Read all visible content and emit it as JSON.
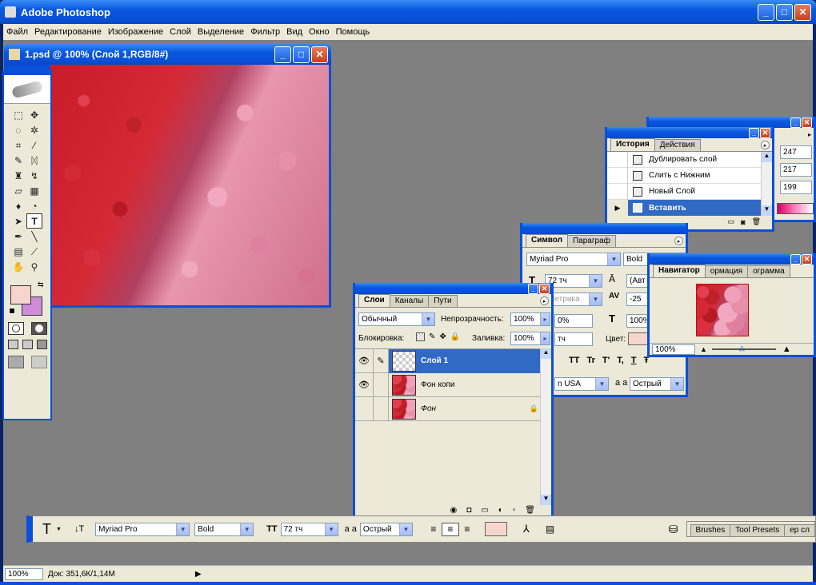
{
  "app": {
    "title": "Adobe Photoshop",
    "menu": [
      "Файл",
      "Редактирование",
      "Изображение",
      "Слой",
      "Выделение",
      "Фильтр",
      "Вид",
      "Окно",
      "Помощь"
    ]
  },
  "document": {
    "title": "1.psd @ 100% (Слой 1,RGB/8#)"
  },
  "history": {
    "tabs": [
      "История",
      "Действия"
    ],
    "items": [
      "Дублировать слой",
      "Слить с Нижним",
      "Новый Слой",
      "Вставить"
    ],
    "selected_index": 3,
    "values": [
      "247",
      "217",
      "199"
    ]
  },
  "character": {
    "tabs": [
      "Символ",
      "Параграф"
    ],
    "font": "Myriad Pro",
    "style": "Bold",
    "size": "72 тч",
    "leading": "(Авт",
    "kerning": "Метрика",
    "tracking": "-25",
    "vscale": "0%",
    "hscale": "100%",
    "baseline": "тч",
    "color_label": "Цвет:",
    "lang": "n USA",
    "aa": "Острый",
    "aa_icon": "a a",
    "style_buttons": [
      "TT",
      "Tr",
      "T'",
      "T,",
      "T",
      "Ŧ"
    ]
  },
  "navigator": {
    "tabs": [
      "Навигатор",
      "ормация",
      "ограмма"
    ],
    "zoom": "100%"
  },
  "layers": {
    "tabs": [
      "Слои",
      "Каналы",
      "Пути"
    ],
    "blend_mode": "Обычный",
    "opacity_label": "Непрозрачность:",
    "opacity": "100%",
    "lock_label": "Блокировка:",
    "fill_label": "Заливка:",
    "fill": "100%",
    "items": [
      {
        "name": "Слой 1",
        "selected": true
      },
      {
        "name": "Фон копи",
        "selected": false
      },
      {
        "name": "Фон",
        "selected": false
      }
    ]
  },
  "options_bar": {
    "font": "Myriad Pro",
    "style": "Bold",
    "size": "72 тч",
    "aa": "Острый",
    "aa_icon": "a a",
    "tabs": [
      "Brushes",
      "Tool Presets",
      "ер сл"
    ]
  },
  "status": {
    "zoom": "100%",
    "doc": "Док: 351,6К/1,14М"
  },
  "colors": {
    "foreground": "#f6d6cc",
    "background": "#d08cd8",
    "workspace": "#808080",
    "selection": "#316ac5"
  }
}
